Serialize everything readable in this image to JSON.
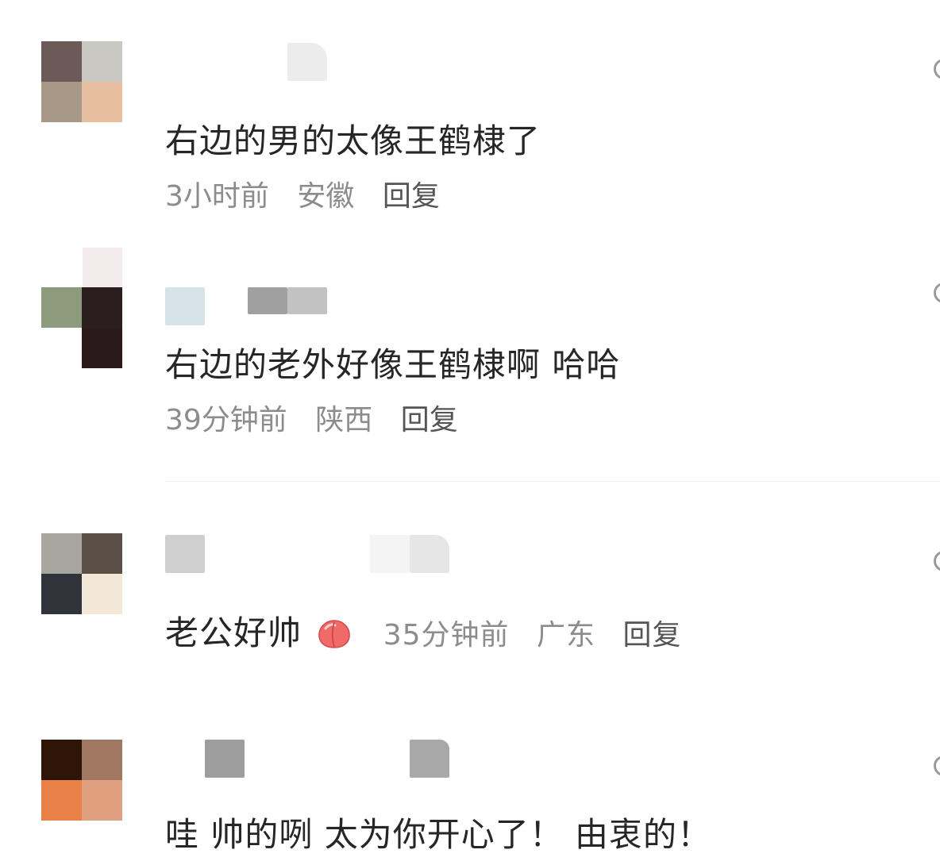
{
  "comments": [
    {
      "text": "右边的男的太像王鹤棣了",
      "time": "3小时前",
      "location": "安徽",
      "reply": "回复",
      "avatar_colors": [
        "#6b5a58",
        "#c9c8c2",
        "#a89888",
        "#e8bea0"
      ],
      "name_colors": [
        "#ffffff",
        "#ececec"
      ]
    },
    {
      "text": "右边的老外好像王鹤棣啊 哈哈",
      "time": "39分钟前",
      "location": "陕西",
      "reply": "回复",
      "avatar_colors": [
        "#8e9a7c",
        "#2a1e1e",
        "#ffffff",
        "#2a1a1c"
      ],
      "name_colors": [
        "#d6e4ea",
        "#a0a0a0",
        "#c2c2c2"
      ]
    },
    {
      "text": "老公好帅",
      "emoji": "peach-emoji",
      "time": "35分钟前",
      "location": "广东",
      "reply": "回复",
      "avatar_colors": [
        "#a8a49e",
        "#5a5048",
        "#30343a",
        "#f2e8d8"
      ],
      "name_colors": [
        "#cfcfcf",
        "#f4f4f4",
        "#e6e6e6"
      ]
    },
    {
      "text": "哇 帅的咧 太为你开心了！ 由衷的！",
      "avatar_colors": [
        "#2e1508",
        "#a07862",
        "#e88048",
        "#e0a080"
      ],
      "name_colors": [
        "#9e9e9e",
        "#a8a8a8"
      ]
    }
  ],
  "accent_colors": {
    "meta_text": "#8c8c8c",
    "body_text": "#262626"
  }
}
